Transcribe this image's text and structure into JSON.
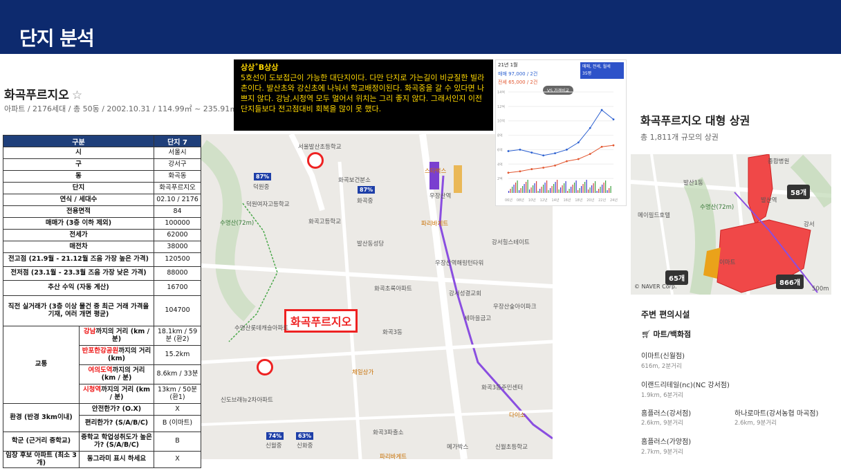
{
  "header": {
    "title": "단지 분석"
  },
  "apartment": {
    "name": "화곡푸르지오",
    "star": "☆",
    "info": "아파트 / 2176세대 / 총 50동 / 2002.10.31 / 114.99㎡ ~ 235.91㎡"
  },
  "table": {
    "header": [
      "구분",
      "단지 7"
    ],
    "rows": [
      [
        "시",
        "서울시"
      ],
      [
        "구",
        "강서구"
      ],
      [
        "동",
        "화곡동"
      ],
      [
        "단지",
        "화곡푸르지오"
      ],
      [
        "연식 / 세대수",
        "02.10 / 2176"
      ],
      [
        "전용면적",
        "84"
      ],
      [
        "매매가 (3층 이하 제외)",
        "100000"
      ],
      [
        "전세가",
        "62000"
      ],
      [
        "매전차",
        "38000"
      ],
      [
        "전고점 (21.9월 - 21.12월 즈음 가장 높은 가격)",
        "120500"
      ],
      [
        "전저점 (23.1월 - 23.3월 즈음 가장 낮은 가격)",
        "88000"
      ],
      [
        "추산 수익 (자동 계산)",
        "16700"
      ],
      [
        "직전 실거래가 (3층 이상 물건 중 최근 거래 가격을 기재, 여러 개면 평균)",
        "104700"
      ]
    ],
    "traffic_label": "교통",
    "traffic": [
      {
        "place": "강남",
        "suffix": "까지의 거리 (km / 분)",
        "value": "18.1km / 59분 (환2)"
      },
      {
        "place": "반포한강공원",
        "suffix": "까지의 거리 (km)",
        "value": "15.2km"
      },
      {
        "place": "여의도역",
        "suffix": "까지의 거리 (km / 분)",
        "value": "8.6km / 33분"
      },
      {
        "place": "시청역",
        "suffix": "까지의 거리 (km / 분)",
        "value": "13km / 50분 (환1)"
      }
    ],
    "env_label": "환경 (반경 3km이내)",
    "env": [
      {
        "q": "안전한가? (O.X)",
        "value": "X"
      },
      {
        "q": "편리한가? (S/A/B/C)",
        "value": "B (이마트)"
      }
    ],
    "school_label": "학군 (근거리 중학교)",
    "school_q": "중학교 학업성취도가 높은가? (S/A/B/C)",
    "school_value": "B",
    "cand_label": "임장 후보 아파트 (최소 3개)",
    "cand_q": "동그라미 표시 하세요",
    "cand_value": "X"
  },
  "comment": {
    "title": "상상˚B상상",
    "body": "5호선이 도보접근이 가능한 대단지이다. 다만 단지로 가는길이 비균질한 빌라촌이다. 발산초와 강신초에 나눠서 학교배정이된다. 화곡중을 갈 수 있다면 나쁘지 않다. 강남,시청역 모두 멀어서 위치는 그리 좋지 않다. 그래서인지 이전 단지들보다 전고점대비 회복을 많이 못 했다."
  },
  "map": {
    "main_label": "화곡푸르지오",
    "flags": [
      "87%",
      "87%",
      "74%",
      "63%"
    ],
    "labels": [
      "서울발산초등학교",
      "화곡보건분소",
      "덕원중",
      "덕원여자고등학교",
      "화곡중",
      "스타벅스",
      "우장산역",
      "수명산(72m)",
      "화곡고등학교",
      "파리바게트",
      "발산동성당",
      "우장산역해링턴타워",
      "강서힐스테이트",
      "화곡초록아파트",
      "강서성결교회",
      "우장산숲아이파크",
      "세마을금고",
      "수명산롯데캐슬아파트",
      "화곡3동",
      "체일상가",
      "신도브래뉴2차아파트",
      "화곡3동주민센터",
      "다이소",
      "신월중",
      "신화중",
      "화곡3파출소",
      "메가박스",
      "신월초등학교",
      "파리바게트"
    ]
  },
  "chart": {
    "period": "21년 1월",
    "buy_line": "매매 97,000 / 2건",
    "rent_line": "전세 65,000 / 2건",
    "selector": "매매, 전세, 월세",
    "selector2": "35평",
    "vs_label": "VS 가격비교",
    "y_ticks": [
      "14억",
      "12억",
      "10억",
      "8억",
      "6억",
      "4억",
      "2억"
    ],
    "x_ticks": [
      "06년",
      "08년",
      "10년",
      "12년",
      "14년",
      "16년",
      "18년",
      "20년",
      "22년",
      "24년"
    ]
  },
  "chart_data": {
    "type": "line",
    "x": [
      "06년",
      "08년",
      "10년",
      "12년",
      "14년",
      "16년",
      "18년",
      "20년",
      "22년",
      "24년"
    ],
    "series": [
      {
        "name": "매매",
        "values": [
          5.8,
          6.0,
          5.6,
          5.2,
          5.5,
          6.0,
          7.0,
          9.0,
          11.5,
          10.2
        ]
      },
      {
        "name": "전세",
        "values": [
          2.8,
          3.0,
          3.3,
          3.5,
          3.8,
          4.4,
          4.7,
          5.4,
          6.4,
          6.6
        ]
      }
    ],
    "ylabel": "",
    "ylim": [
      0,
      14
    ]
  },
  "mall": {
    "title": "화곡푸르지오 대형 상권",
    "subtitle": "총 1,811개 규모의 상권",
    "counts": [
      "58개",
      "65개",
      "866개"
    ],
    "map_labels": [
      "발산1동",
      "수명산(72m)",
      "발산역",
      "메이필드호텔",
      "강서",
      "이마트",
      "종합병원"
    ],
    "copyright": "© NAVER Corp.",
    "scale": "500m"
  },
  "convenience": {
    "title": "주변 편의시설",
    "category": "마트/백화점",
    "stores": [
      {
        "name": "이마트(신월점)",
        "dist": "616m, 2분거리"
      },
      {
        "name": "이랜드리테일(nc)(NC 강서점)",
        "dist": "1.9km, 6분거리"
      },
      {
        "name": "홈플러스(강서점)",
        "dist": "2.6km, 9분거리"
      },
      {
        "name": "하나로마트(강서농협 마곡점)",
        "dist": "2.6km, 9분거리"
      },
      {
        "name": "홈플러스(가양점)",
        "dist": "2.7km, 9분거리"
      }
    ]
  }
}
